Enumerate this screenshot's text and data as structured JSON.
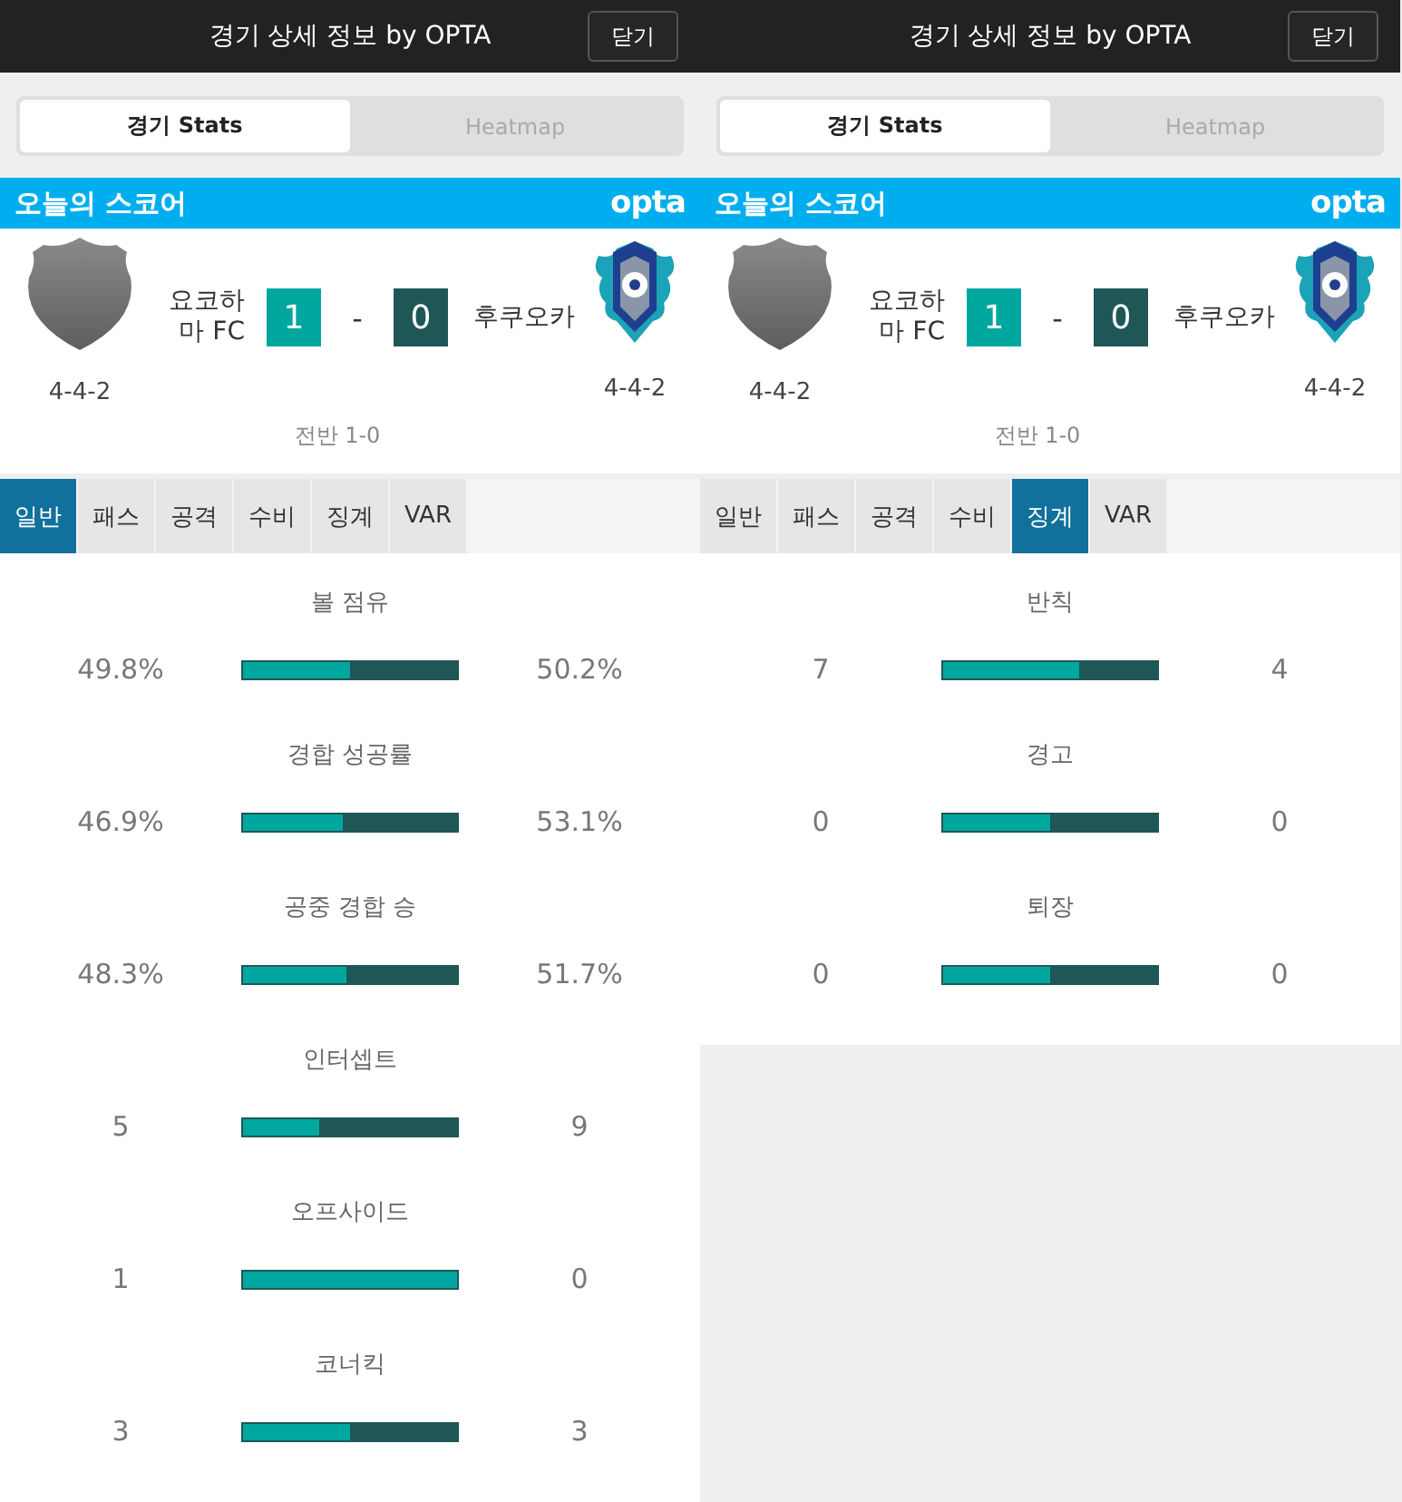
{
  "panels": [
    {
      "header": {
        "title": "경기 상세 정보 by OPTA",
        "close_button": "닫기"
      },
      "view_tabs": [
        {
          "label": "경기 Stats",
          "selected": true
        },
        {
          "label": "Heatmap",
          "selected": false
        }
      ],
      "scoreboard": {
        "title": "오늘의 스코어",
        "logo": "opta",
        "home": {
          "name": "요코하마 FC",
          "score": "1",
          "formation": "4-4-2"
        },
        "separator": "-",
        "away": {
          "name": "후쿠오카",
          "score": "0",
          "formation": "4-4-2"
        },
        "half_time": "전반 1-0"
      },
      "stat_tabs": [
        {
          "label": "일반",
          "selected": true
        },
        {
          "label": "패스",
          "selected": false
        },
        {
          "label": "공격",
          "selected": false
        },
        {
          "label": "수비",
          "selected": false
        },
        {
          "label": "징계",
          "selected": false
        },
        {
          "label": "VAR",
          "selected": false
        }
      ],
      "stats": [
        {
          "label": "볼 점유",
          "home": "49.8%",
          "away": "50.2%",
          "level": 0.498
        },
        {
          "label": "경합 성공률",
          "home": "46.9%",
          "away": "53.1%",
          "level": 0.469
        },
        {
          "label": "공중 경합 승",
          "home": "48.3%",
          "away": "51.7%",
          "level": 0.483
        },
        {
          "label": "인터셉트",
          "home": "5",
          "away": "9",
          "level": 0.357
        },
        {
          "label": "오프사이드",
          "home": "1",
          "away": "0",
          "level": 1
        },
        {
          "label": "코너킥",
          "home": "3",
          "away": "3",
          "level": 0.5
        }
      ]
    },
    {
      "header": {
        "title": "경기 상세 정보 by OPTA",
        "close_button": "닫기"
      },
      "view_tabs": [
        {
          "label": "경기 Stats",
          "selected": true
        },
        {
          "label": "Heatmap",
          "selected": false
        }
      ],
      "scoreboard": {
        "title": "오늘의 스코어",
        "logo": "opta",
        "home": {
          "name": "요코하마 FC",
          "score": "1",
          "formation": "4-4-2"
        },
        "separator": "-",
        "away": {
          "name": "후쿠오카",
          "score": "0",
          "formation": "4-4-2"
        },
        "half_time": "전반 1-0"
      },
      "stat_tabs": [
        {
          "label": "일반",
          "selected": false
        },
        {
          "label": "패스",
          "selected": false
        },
        {
          "label": "공격",
          "selected": false
        },
        {
          "label": "수비",
          "selected": false
        },
        {
          "label": "징계",
          "selected": true
        },
        {
          "label": "VAR",
          "selected": false
        }
      ],
      "stats": [
        {
          "label": "반칙",
          "home": "7",
          "away": "4",
          "level": 0.636
        },
        {
          "label": "경고",
          "home": "0",
          "away": "0",
          "level": 0.5
        },
        {
          "label": "퇴장",
          "home": "0",
          "away": "0",
          "level": 0.5
        }
      ]
    }
  ]
}
